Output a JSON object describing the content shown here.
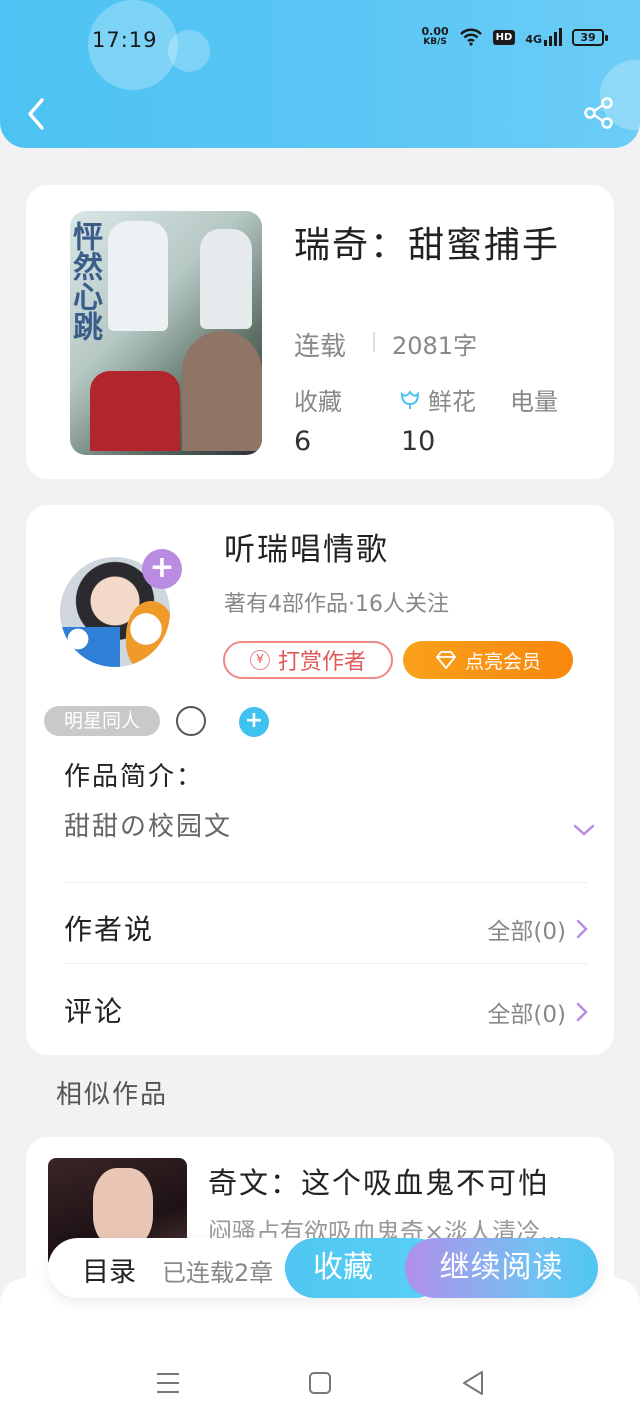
{
  "status_bar": {
    "time": "17:19",
    "net_speed_value": "0.00",
    "net_speed_unit": "KB/S",
    "hd_label": "HD",
    "network_label": "4G",
    "battery_level": "39"
  },
  "book": {
    "title": "瑞奇：甜蜜捕手",
    "status": "连载",
    "word_count": "2081字",
    "stats": [
      {
        "label": "收藏",
        "value": "6"
      },
      {
        "label": "鲜花",
        "value": "10"
      },
      {
        "label": "电量",
        "value": ""
      }
    ],
    "cover_text": "怦然心跳"
  },
  "author": {
    "name": "听瑞唱情歌",
    "meta": "著有4部作品·16人关注",
    "reward_label": "打赏作者",
    "reward_icon_text": "¥",
    "vip_label": "点亮会员",
    "follow_symbol": "+"
  },
  "tags": {
    "items": [
      "明星同人"
    ],
    "add_symbol": "+"
  },
  "intro": {
    "title": "作品简介：",
    "text": "甜甜の校园文"
  },
  "sections": [
    {
      "label": "作者说",
      "link": "全部(0)"
    },
    {
      "label": "评论",
      "link": "全部(0)"
    }
  ],
  "similar": {
    "heading": "相似作品",
    "items": [
      {
        "title": "奇文：这个吸血鬼不可怕",
        "desc": "闷骚占有欲吸血鬼奇×淡人清冷..."
      }
    ]
  },
  "bottom_bar": {
    "toc_label": "目录",
    "chapter_count": "已连载2章",
    "favorite_label": "收藏",
    "continue_label": "继续阅读"
  },
  "colors": {
    "header_blue": "#4cc3f2",
    "accent_purple": "#b98ce2",
    "vip_orange": "#f9a11b",
    "reward_red": "#e05a5a"
  },
  "icons": [
    "back-arrow-icon",
    "share-icon",
    "flower-icon",
    "yen-icon",
    "diamond-icon",
    "chevron-down-icon",
    "chevron-right-icon",
    "menu-icon",
    "home-icon",
    "back-triangle-icon"
  ]
}
